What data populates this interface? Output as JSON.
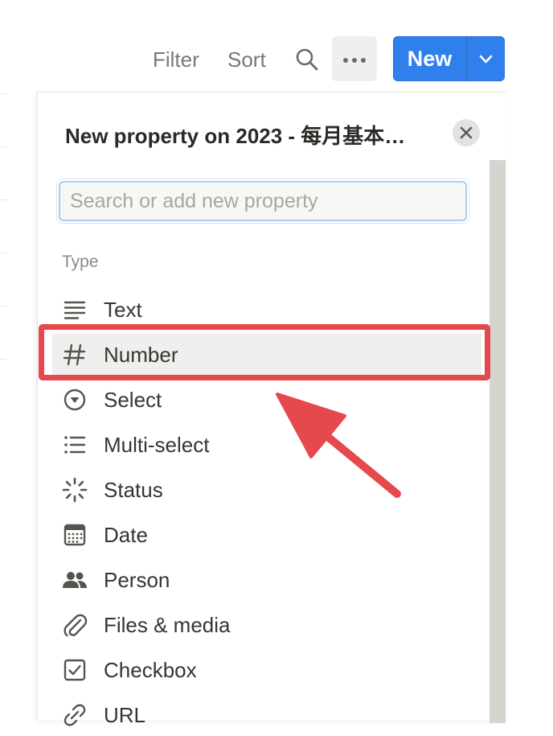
{
  "toolbar": {
    "filter_label": "Filter",
    "sort_label": "Sort",
    "search_icon": "search-icon",
    "more_icon": "more-horizontal-icon",
    "new_label": "New",
    "new_dropdown_icon": "chevron-down-icon",
    "accent_color": "#2f80ed"
  },
  "panel": {
    "title": "New property on 2023 - 每月基本…",
    "close_icon": "close-icon",
    "search_placeholder": "Search or add new property",
    "search_value": "",
    "section_label": "Type",
    "items": [
      {
        "label": "Text",
        "icon": "text-lines-icon"
      },
      {
        "label": "Number",
        "icon": "hash-icon",
        "selected": true
      },
      {
        "label": "Select",
        "icon": "select-circle-chevron-icon"
      },
      {
        "label": "Multi-select",
        "icon": "bulleted-list-icon"
      },
      {
        "label": "Status",
        "icon": "status-spinner-icon"
      },
      {
        "label": "Date",
        "icon": "calendar-icon"
      },
      {
        "label": "Person",
        "icon": "people-icon"
      },
      {
        "label": "Files & media",
        "icon": "paperclip-icon"
      },
      {
        "label": "Checkbox",
        "icon": "checkbox-icon"
      },
      {
        "label": "URL",
        "icon": "link-icon"
      }
    ]
  },
  "annotation": {
    "highlight_color": "#e5484d",
    "highlight_target": "Number"
  }
}
